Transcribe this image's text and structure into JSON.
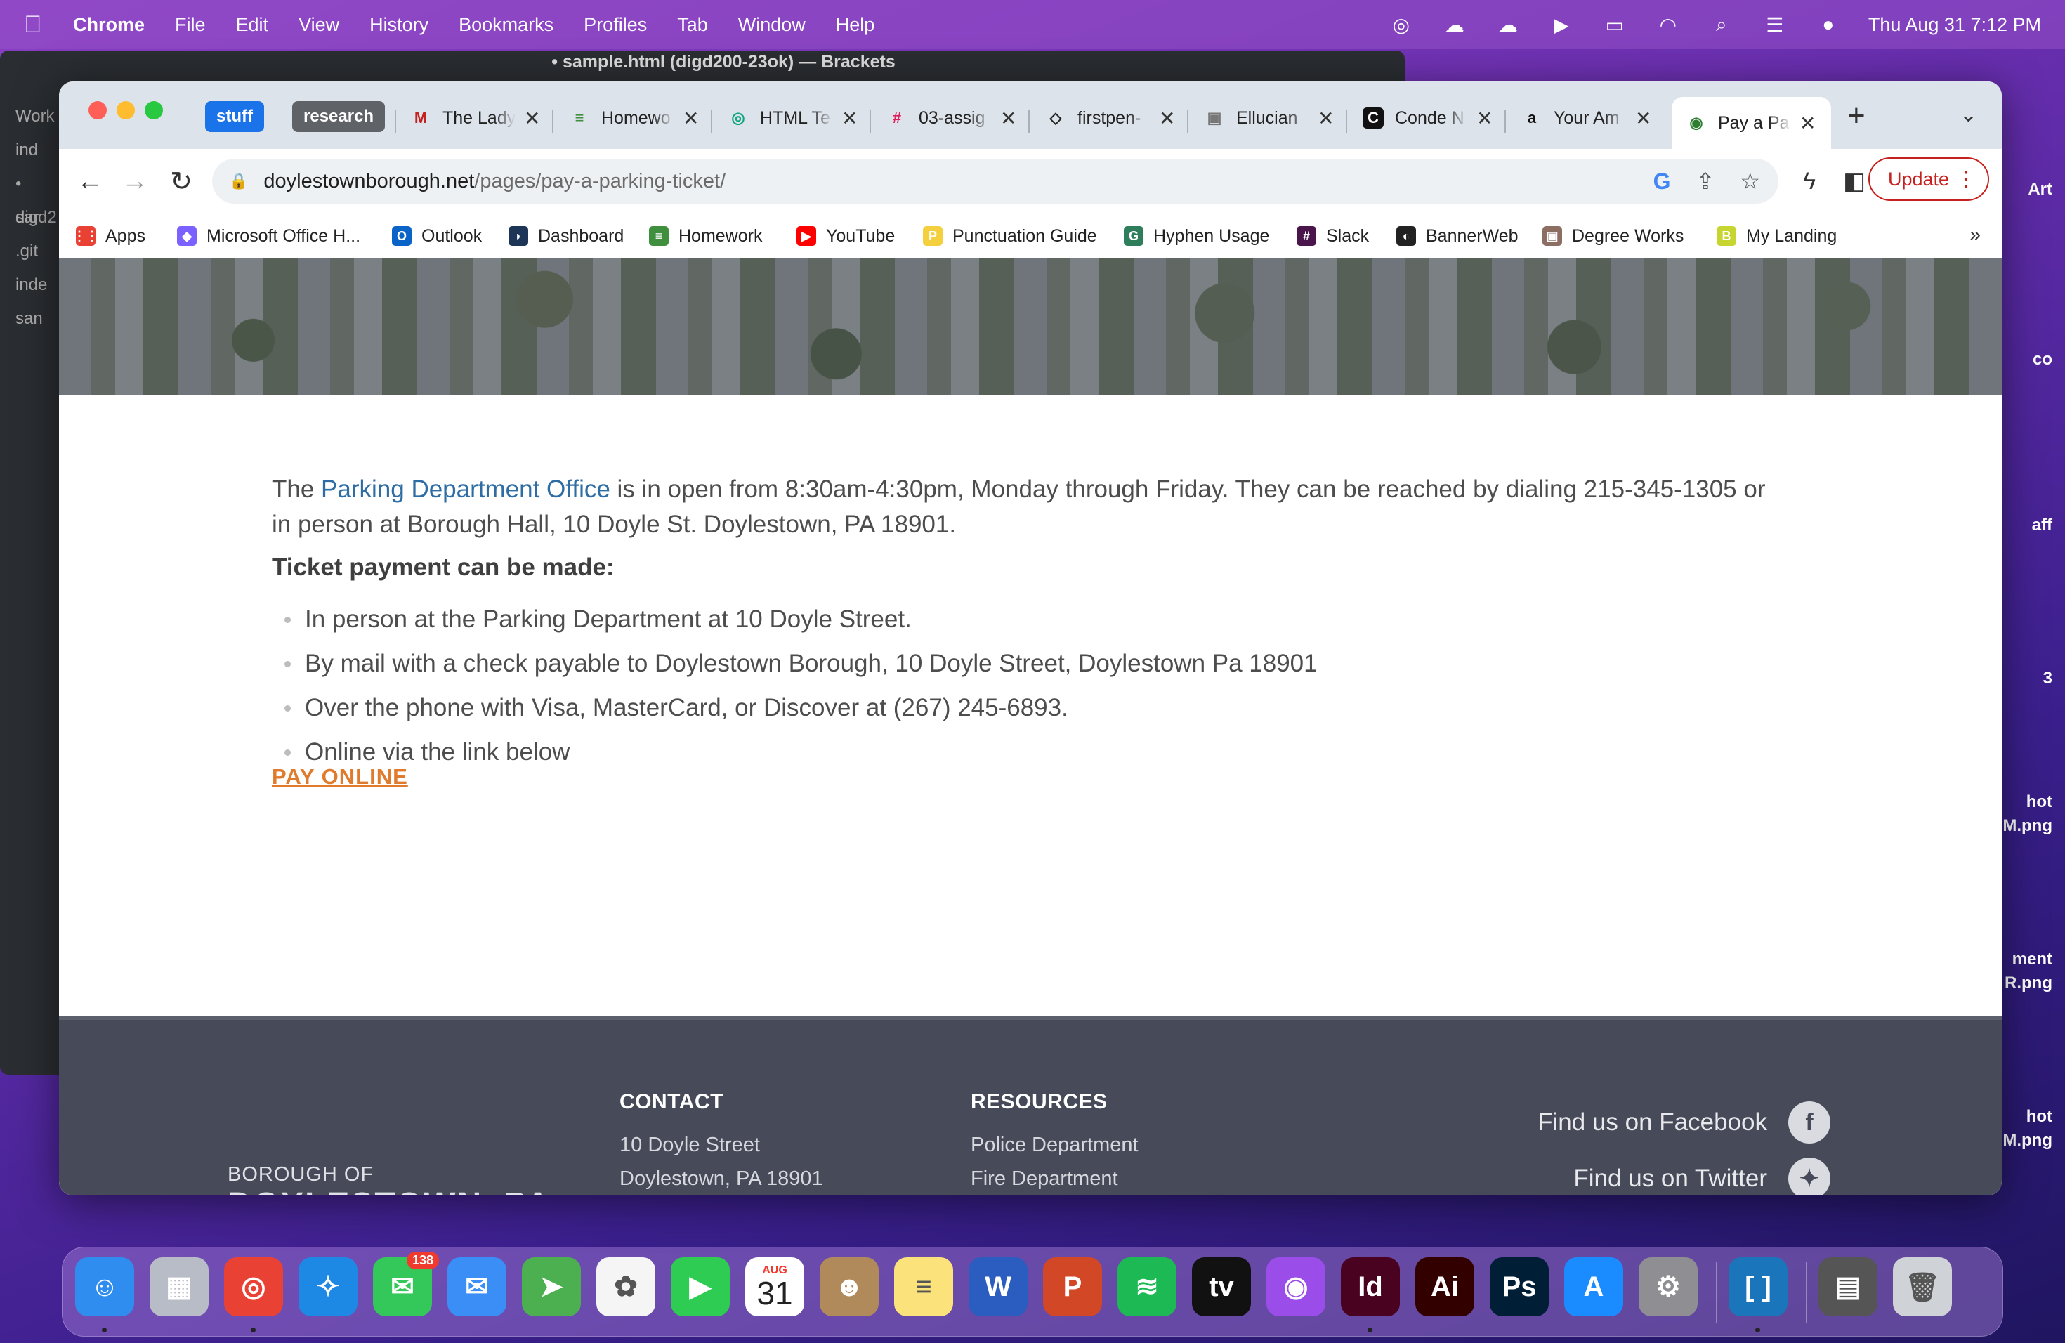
{
  "menubar": {
    "app": "Chrome",
    "items": [
      "File",
      "Edit",
      "View",
      "History",
      "Bookmarks",
      "Profiles",
      "Tab",
      "Window",
      "Help"
    ],
    "clock": "Thu Aug 31  7:12 PM"
  },
  "brackets": {
    "title": "• sample.html (digd200-23ok) — Brackets",
    "sidebar": [
      "Work",
      "ind",
      "• sar",
      "digd2",
      "  .git",
      "inde",
      "san"
    ]
  },
  "desktop": {
    "labels": [
      "Art",
      "co",
      "aff",
      "3",
      "hot",
      "M.png",
      "ment",
      "R.png",
      "hot",
      "M.png"
    ]
  },
  "chrome": {
    "tab_groups": [
      {
        "label": "stuff",
        "color": "#1a73e8"
      },
      {
        "label": "research",
        "color": "#5f6368"
      }
    ],
    "tabs": [
      {
        "title": "The Lady",
        "fav": "M",
        "fav_color": "#c5221f"
      },
      {
        "title": "Homewo",
        "fav": "≡",
        "fav_color": "#3f8f3f"
      },
      {
        "title": "HTML Te",
        "fav": "◎",
        "fav_color": "#10a37f"
      },
      {
        "title": "03-assig",
        "fav": "#",
        "fav_color": "#e01e5a"
      },
      {
        "title": "firstpen-",
        "fav": "◇",
        "fav_color": "#222222"
      },
      {
        "title": "Ellucian",
        "fav": "▣",
        "fav_color": "#777777"
      },
      {
        "title": "Conde N",
        "fav": "C",
        "fav_color": "#111111"
      },
      {
        "title": "Your Am",
        "fav": "a",
        "fav_color": "#111111"
      },
      {
        "title": "Pay a Pa",
        "fav": "◉",
        "fav_color": "#2e7d32",
        "active": true
      }
    ],
    "url_domain": "doylestownborough.net",
    "url_path": "/pages/pay-a-parking-ticket/",
    "update_label": "Update",
    "bookmarks": [
      {
        "label": "Apps",
        "color": "#e94235"
      },
      {
        "label": "Microsoft Office H...",
        "color": "#7b61ff"
      },
      {
        "label": "Outlook",
        "color": "#0a64c7"
      },
      {
        "label": "Dashboard",
        "color": "#1d3557"
      },
      {
        "label": "Homework",
        "color": "#3f8f3f"
      },
      {
        "label": "YouTube",
        "color": "#ff0000"
      },
      {
        "label": "Punctuation Guide",
        "color": "#f4d03f"
      },
      {
        "label": "Hyphen Usage",
        "color": "#2e7d5b"
      },
      {
        "label": "Slack",
        "color": "#4a154b"
      },
      {
        "label": "BannerWeb",
        "color": "#222222"
      },
      {
        "label": "Degree Works",
        "color": "#8d6e63"
      },
      {
        "label": "My Landing",
        "color": "#c6d530"
      }
    ]
  },
  "page": {
    "intro_before": "The ",
    "intro_link": "Parking Department Office",
    "intro_after": " is in open from 8:30am-4:30pm, Monday through Friday. They can be reached by dialing 215-345-1305 or in person at Borough Hall, 10 Doyle St. Doylestown, PA 18901.",
    "payment_heading": "Ticket payment can be made:",
    "methods": [
      "In person at the Parking Department at 10 Doyle Street.",
      "By mail with a check payable to Doylestown Borough, 10 Doyle Street, Doylestown Pa 18901",
      "Over the phone with Visa, MasterCard, or Discover at (267) 245-6893.",
      "Online via the link below"
    ],
    "pay_online": "PAY ONLINE"
  },
  "footer": {
    "logo_line1": "BOROUGH OF",
    "logo_line2": "DOYLESTOWN, PA",
    "contact_heading": "CONTACT",
    "contact": [
      "10 Doyle Street",
      "Doylestown, PA 18901"
    ],
    "resources_heading": "RESOURCES",
    "resources": [
      "Police Department",
      "Fire Department"
    ],
    "facebook": "Find us on Facebook",
    "twitter": "Find us on Twitter"
  },
  "dock": {
    "messages_badge": "138",
    "calendar_month": "AUG",
    "calendar_day": "31",
    "apps": [
      "Finder",
      "Launchpad",
      "Chrome",
      "Safari",
      "Messages",
      "Mail",
      "Maps",
      "Photos",
      "FaceTime",
      "Calendar",
      "Contacts",
      "Notes",
      "Word",
      "PowerPoint",
      "Spotify",
      "TV",
      "Podcasts",
      "InDesign",
      "Illustrator",
      "Photoshop",
      "App Store",
      "System Settings",
      "Brackets",
      "Downloads",
      "Trash"
    ]
  }
}
